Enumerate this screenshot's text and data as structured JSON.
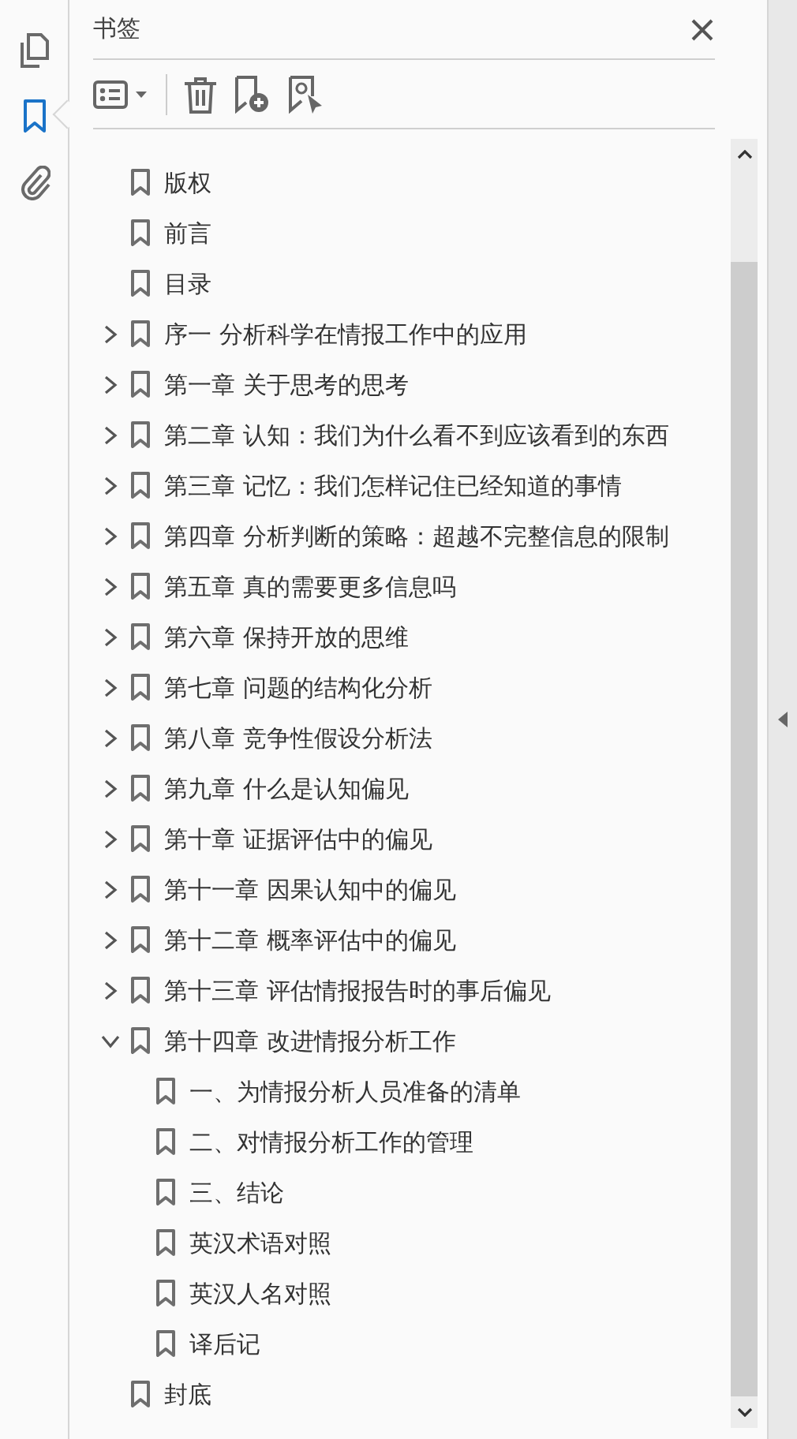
{
  "panel": {
    "title": "书签"
  },
  "rail": [
    {
      "kind": "pages",
      "selected": false
    },
    {
      "kind": "bookmarks",
      "selected": true
    },
    {
      "kind": "attachments",
      "selected": false
    }
  ],
  "bookmarks": [
    {
      "label": "版权"
    },
    {
      "label": "前言"
    },
    {
      "label": "目录"
    },
    {
      "label": "序一 分析科学在情报工作中的应用",
      "expanded": false
    },
    {
      "label": "第一章 关于思考的思考",
      "expanded": false
    },
    {
      "label": "第二章 认知：我们为什么看不到应该看到的东西",
      "expanded": false
    },
    {
      "label": "第三章 记忆：我们怎样记住已经知道的事情",
      "expanded": false
    },
    {
      "label": "第四章 分析判断的策略：超越不完整信息的限制",
      "expanded": false
    },
    {
      "label": "第五章 真的需要更多信息吗",
      "expanded": false
    },
    {
      "label": "第六章 保持开放的思维",
      "expanded": false
    },
    {
      "label": "第七章 问题的结构化分析",
      "expanded": false
    },
    {
      "label": "第八章 竞争性假设分析法",
      "expanded": false
    },
    {
      "label": "第九章 什么是认知偏见",
      "expanded": false
    },
    {
      "label": "第十章 证据评估中的偏见",
      "expanded": false
    },
    {
      "label": "第十一章 因果认知中的偏见",
      "expanded": false
    },
    {
      "label": "第十二章 概率评估中的偏见",
      "expanded": false
    },
    {
      "label": "第十三章 评估情报报告时的事后偏见",
      "expanded": false
    },
    {
      "label": "第十四章 改进情报分析工作",
      "expanded": true,
      "children": [
        {
          "label": "一、为情报分析人员准备的清单"
        },
        {
          "label": "二、对情报分析工作的管理"
        },
        {
          "label": "三、结论"
        },
        {
          "label": "英汉术语对照"
        },
        {
          "label": "英汉人名对照"
        },
        {
          "label": "译后记"
        }
      ]
    },
    {
      "label": "封底"
    }
  ]
}
